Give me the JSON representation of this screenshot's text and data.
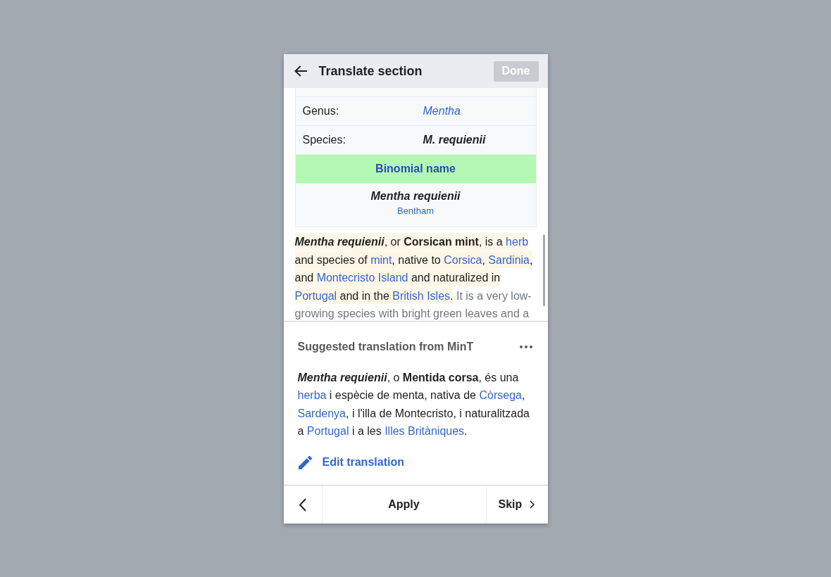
{
  "header": {
    "title": "Translate section",
    "done": {
      "label": "Done",
      "disabled": true
    }
  },
  "infobox": {
    "rows": [
      {
        "kind": "field",
        "label": "Genus:",
        "value": "Mentha",
        "link": true,
        "italic": true,
        "bold": false
      },
      {
        "kind": "field",
        "label": "Species:",
        "value": "M. requienii",
        "link": false,
        "italic": true,
        "bold": true
      },
      {
        "kind": "heading",
        "label": "Binomial name",
        "link": true
      },
      {
        "kind": "binomial",
        "value": "Mentha requienii",
        "authority": "Bentham"
      }
    ]
  },
  "source": {
    "sentences": [
      {
        "selected": true,
        "runs": [
          {
            "kind": "term",
            "text": "Mentha requienii"
          },
          {
            "kind": "text",
            "text": ", or **Corsican mint**, is a "
          },
          {
            "kind": "link",
            "text": "herb"
          },
          {
            "kind": "text",
            "text": " and species of "
          },
          {
            "kind": "link",
            "text": "mint"
          },
          {
            "kind": "text",
            "text": ", native to "
          },
          {
            "kind": "link",
            "text": "Corsica"
          },
          {
            "kind": "text",
            "text": ", "
          },
          {
            "kind": "link",
            "text": "Sardinia"
          },
          {
            "kind": "text",
            "text": ", and "
          },
          {
            "kind": "link",
            "text": "Montecristo Island"
          },
          {
            "kind": "text",
            "text": " and naturalized in "
          },
          {
            "kind": "link",
            "text": "Portugal"
          },
          {
            "kind": "text",
            "text": " and in the "
          },
          {
            "kind": "link",
            "text": "British Isles"
          },
          {
            "kind": "text",
            "text": "."
          }
        ]
      },
      {
        "selected": false,
        "runs": [
          {
            "kind": "text",
            "text": "It is a very low-growing species with bright green leaves and a"
          }
        ]
      }
    ]
  },
  "suggestion": {
    "title": "Suggested translation from MinT",
    "runs": [
      {
        "kind": "term",
        "text": "Mentha requienii"
      },
      {
        "kind": "text",
        "text": ", o **Mentida corsa**, és una "
      },
      {
        "kind": "link",
        "text": "herba"
      },
      {
        "kind": "text",
        "text": " i espècie de menta, nativa de "
      },
      {
        "kind": "link",
        "text": "Còrsega"
      },
      {
        "kind": "text",
        "text": ", "
      },
      {
        "kind": "link",
        "text": "Sardenya"
      },
      {
        "kind": "text",
        "text": ", i l'illa de Montecristo, i naturalitzada a "
      },
      {
        "kind": "link",
        "text": "Portugal"
      },
      {
        "kind": "text",
        "text": " i a les "
      },
      {
        "kind": "link",
        "text": "Illes Britàniques"
      },
      {
        "kind": "text",
        "text": "."
      }
    ],
    "edit_link": "Edit translation"
  },
  "footer": {
    "buttons": [
      {
        "kind": "previous"
      },
      {
        "kind": "apply",
        "label": "Apply"
      },
      {
        "kind": "skip",
        "label": "Skip"
      }
    ]
  }
}
